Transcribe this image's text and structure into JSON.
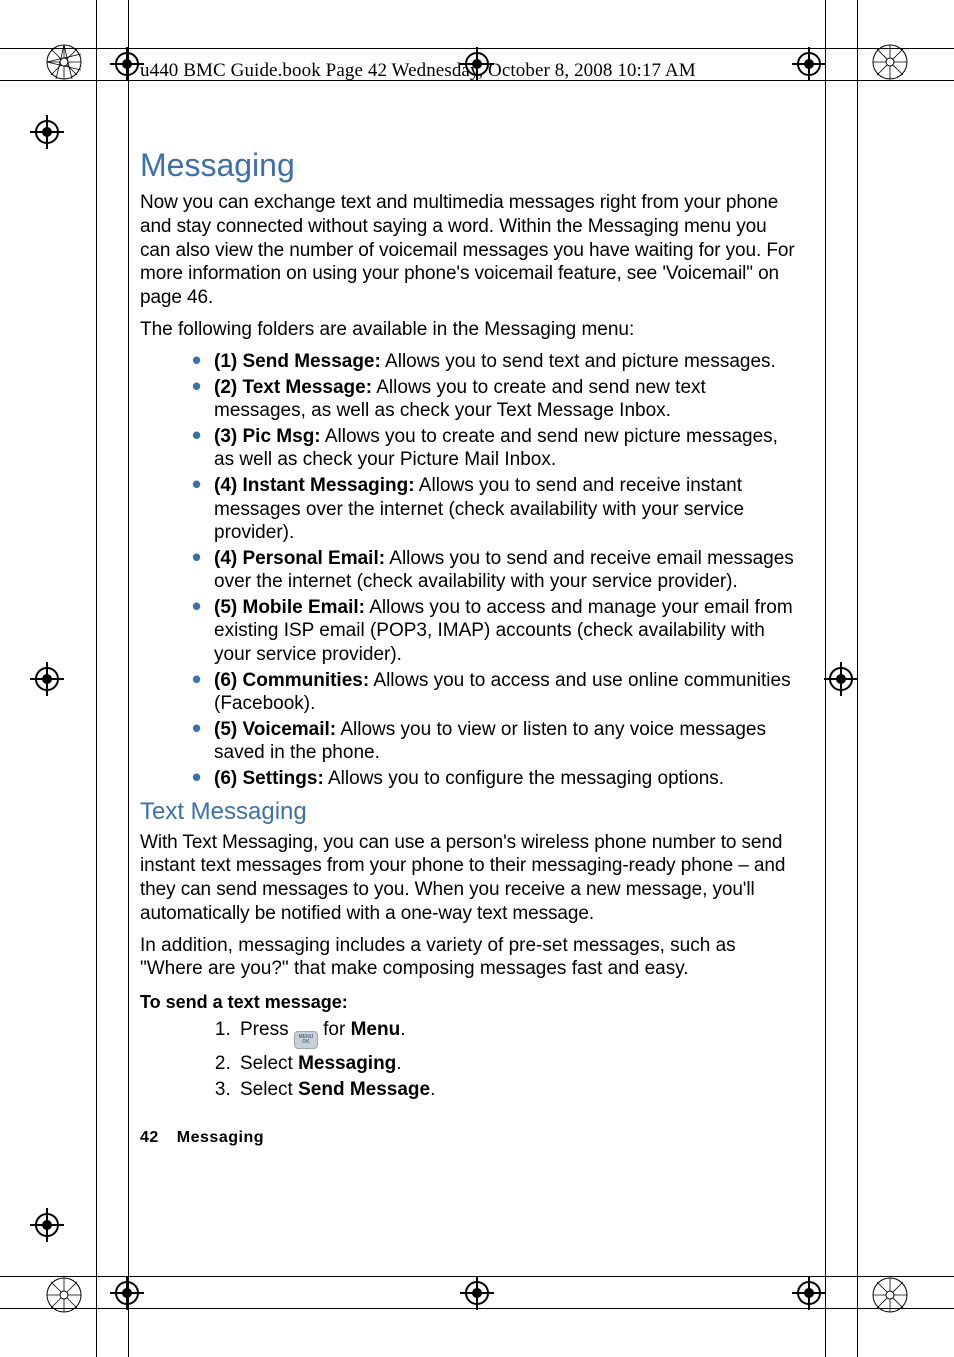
{
  "header": "u440 BMC Guide.book  Page 42  Wednesday, October 8, 2008  10:17 AM",
  "title": "Messaging",
  "intro1": "Now you can exchange text and multimedia messages right from your phone and stay connected without saying a word. Within the Messaging menu you can also view the number of voicemail messages you have waiting for you. For more information on using your phone's voicemail feature, see 'Voicemail\" on page 46.",
  "intro2": "The following folders are available in the Messaging menu:",
  "bullets": [
    {
      "label": "(1) Send Message:",
      "text": " Allows you to send text and picture messages."
    },
    {
      "label": "(2) Text Message:",
      "text": " Allows you to create and send new text messages, as well as check your Text Message Inbox."
    },
    {
      "label": "(3) Pic Msg:",
      "text": " Allows you to create and send new picture messages, as well as check your Picture Mail Inbox."
    },
    {
      "label": "(4) Instant Messaging:",
      "text": " Allows you to send and receive instant messages over the internet (check availability with your service provider)."
    },
    {
      "label": "(4) Personal Email:",
      "text": " Allows you to send and receive email messages over the internet (check availability with your service provider)."
    },
    {
      "label": "(5) Mobile Email:",
      "text": " Allows you to access and manage your email from existing ISP email (POP3, IMAP) accounts (check availability with your service provider)."
    },
    {
      "label": "(6) Communities:",
      "text": " Allows you to access and use online communities (Facebook)."
    },
    {
      "label": "(5) Voicemail:",
      "text": " Allows you to view or listen to any voice messages saved in the phone."
    },
    {
      "label": "(6) Settings:",
      "text": " Allows you to configure the messaging options."
    }
  ],
  "sub_title": "Text Messaging",
  "sub_para1": "With Text Messaging, you can use a person's wireless phone number to send instant text messages from your phone to their messaging-ready phone – and they can send messages to you. When you receive a new message, you'll automatically be notified with a one-way text message.",
  "sub_para2": "In addition, messaging includes a variety of pre-set messages, such as \"Where are you?\" that make composing messages fast and easy.",
  "howto_head": "To send a text message:",
  "steps": {
    "s1_pre": "Press ",
    "s1_post": " for ",
    "s1_bold": "Menu",
    "s2_pre": "Select ",
    "s2_bold": "Messaging",
    "s3_pre": "Select ",
    "s3_bold": "Send Message",
    "key_top": "MENU",
    "key_bot": "OK"
  },
  "footer": {
    "page": "42",
    "section": "Messaging"
  }
}
